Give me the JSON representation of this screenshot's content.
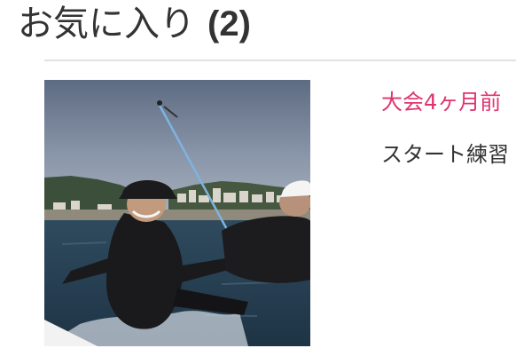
{
  "favorites": {
    "title": "お気に入り",
    "count": "(2)"
  },
  "post": {
    "meta": "大会4ヶ月前",
    "excerpt": "スタート練習",
    "image_alt": "sailing photo"
  },
  "colors": {
    "accent": "#e0336e",
    "text": "#333333",
    "divider": "#e2e2e2"
  }
}
